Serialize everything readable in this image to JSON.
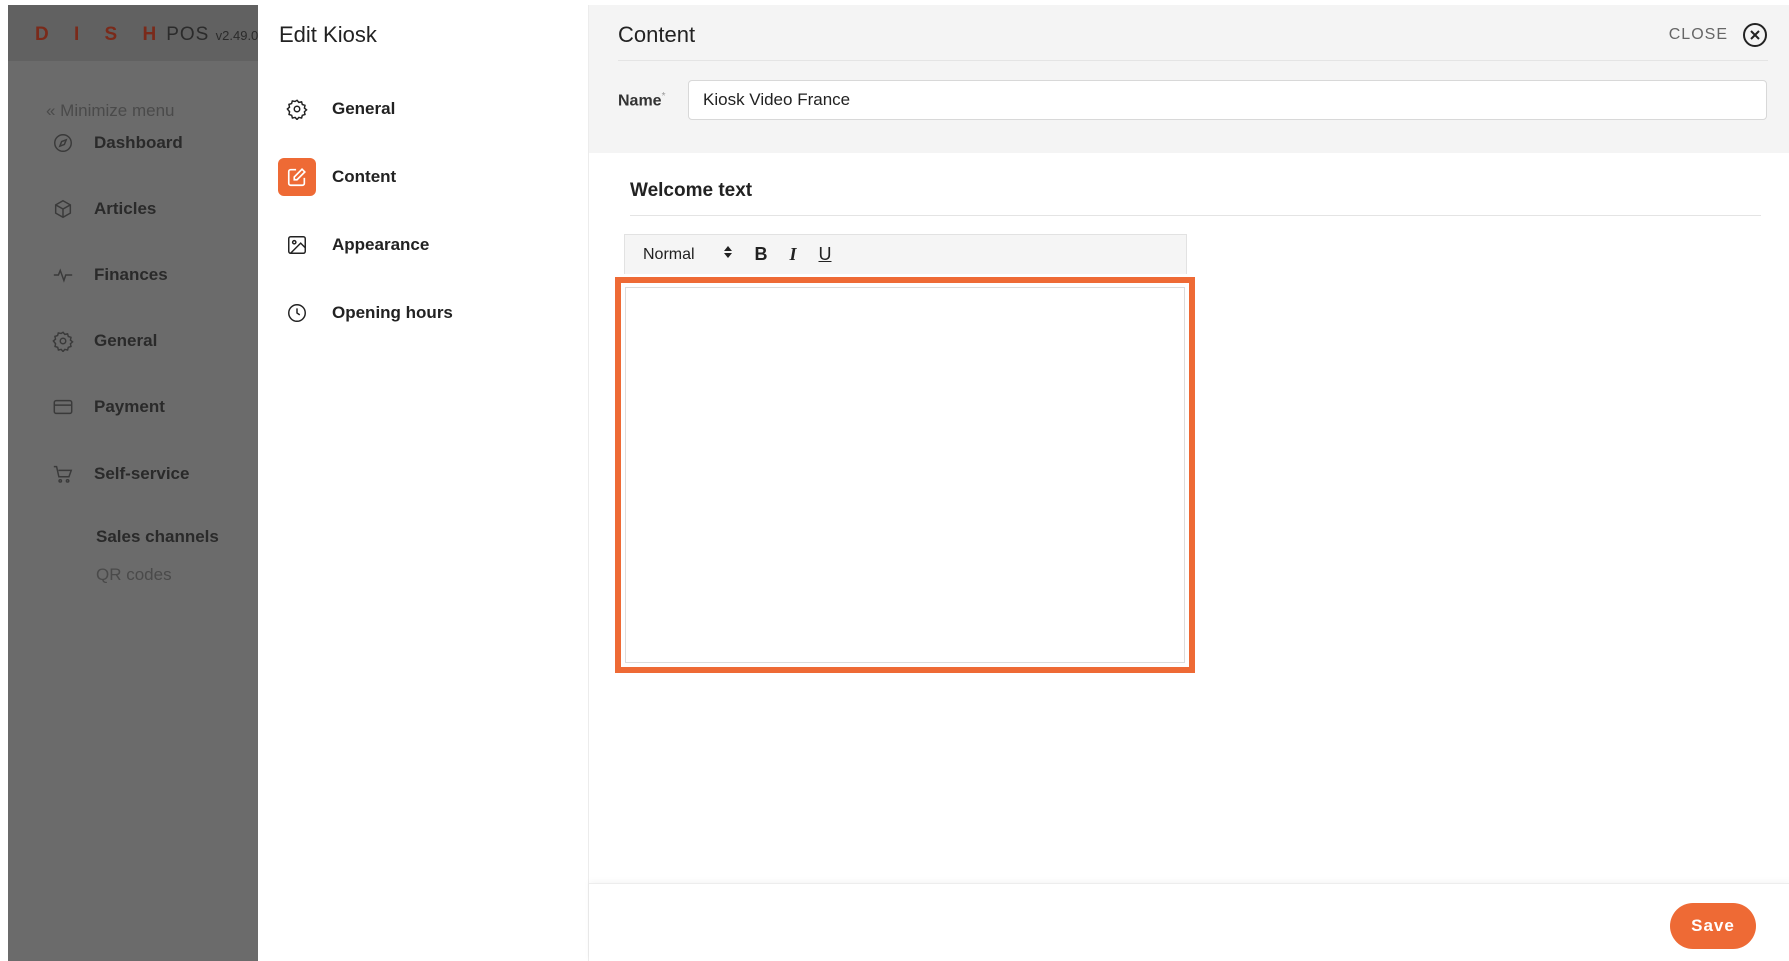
{
  "brand": {
    "logo": "D I S H",
    "product": "POS",
    "version": "v2.49.0"
  },
  "sidebar": {
    "minimize_label": "« Minimize menu",
    "items": [
      {
        "label": "Dashboard",
        "icon": "compass-icon"
      },
      {
        "label": "Articles",
        "icon": "box-icon"
      },
      {
        "label": "Finances",
        "icon": "pulse-icon"
      },
      {
        "label": "General",
        "icon": "gear-icon"
      },
      {
        "label": "Payment",
        "icon": "card-icon"
      },
      {
        "label": "Self-service",
        "icon": "cart-icon"
      }
    ],
    "subitems": [
      {
        "label": "Sales channels"
      },
      {
        "label": "QR codes"
      }
    ]
  },
  "edit_panel": {
    "title": "Edit Kiosk",
    "items": [
      {
        "label": "General",
        "icon": "gear-icon",
        "active": false
      },
      {
        "label": "Content",
        "icon": "edit-icon",
        "active": true
      },
      {
        "label": "Appearance",
        "icon": "image-icon",
        "active": false
      },
      {
        "label": "Opening hours",
        "icon": "clock-icon",
        "active": false
      }
    ]
  },
  "content": {
    "title": "Content",
    "close_label": "CLOSE",
    "name_label": "Name",
    "name_required": "*",
    "name_value": "Kiosk Video France",
    "welcome_title": "Welcome text",
    "toolbar": {
      "format_value": "Normal",
      "bold": "B",
      "italic": "I",
      "underline": "U"
    },
    "welcome_value": "",
    "save_label": "Save"
  },
  "colors": {
    "accent": "#ee6a35",
    "sidebar_overlay": "#6b6b6b"
  }
}
